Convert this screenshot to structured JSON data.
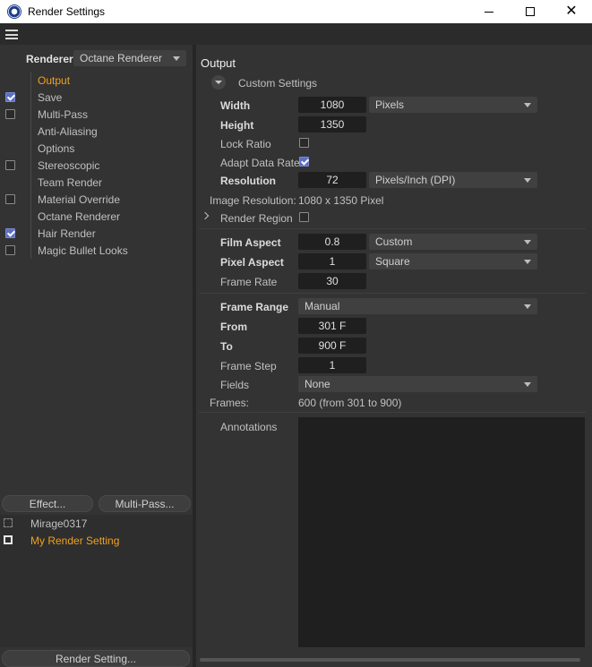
{
  "window": {
    "title": "Render Settings",
    "close_glyph": "✕"
  },
  "left": {
    "renderer_label": "Renderer",
    "renderer_value": "Octane Renderer",
    "passes": [
      {
        "label": "Output",
        "checkbox": "none",
        "active": true
      },
      {
        "label": "Save",
        "checkbox": "checked",
        "active": false
      },
      {
        "label": "Multi-Pass",
        "checkbox": "unchecked",
        "active": false
      },
      {
        "label": "Anti-Aliasing",
        "checkbox": "none",
        "active": false
      },
      {
        "label": "Options",
        "checkbox": "none",
        "active": false
      },
      {
        "label": "Stereoscopic",
        "checkbox": "unchecked",
        "active": false
      },
      {
        "label": "Team Render",
        "checkbox": "none",
        "active": false
      },
      {
        "label": "Material Override",
        "checkbox": "unchecked",
        "active": false
      },
      {
        "label": "Octane Renderer",
        "checkbox": "none",
        "active": false
      },
      {
        "label": "Hair Render",
        "checkbox": "checked",
        "active": false
      },
      {
        "label": "Magic Bullet Looks",
        "checkbox": "unchecked",
        "active": false
      }
    ],
    "effect_button": "Effect...",
    "multipass_button": "Multi-Pass...",
    "settings": [
      {
        "label": "Mirage0317",
        "active": false
      },
      {
        "label": "My Render Setting",
        "active": true
      }
    ],
    "render_setting_button": "Render Setting..."
  },
  "output": {
    "section_title": "Output",
    "custom_settings": "Custom Settings",
    "width_label": "Width",
    "width_value": "1080",
    "width_unit": "Pixels",
    "height_label": "Height",
    "height_value": "1350",
    "lock_ratio_label": "Lock Ratio",
    "lock_ratio_checked": false,
    "adapt_data_rate_label": "Adapt Data Rate",
    "adapt_data_rate_checked": true,
    "resolution_label": "Resolution",
    "resolution_value": "72",
    "resolution_unit": "Pixels/Inch (DPI)",
    "image_resolution_label": "Image Resolution:",
    "image_resolution_value": "1080 x 1350 Pixel",
    "render_region_label": "Render Region",
    "render_region_checked": false,
    "film_aspect_label": "Film Aspect",
    "film_aspect_value": "0.8",
    "film_aspect_preset": "Custom",
    "pixel_aspect_label": "Pixel Aspect",
    "pixel_aspect_value": "1",
    "pixel_aspect_preset": "Square",
    "frame_rate_label": "Frame Rate",
    "frame_rate_value": "30",
    "frame_range_label": "Frame Range",
    "frame_range_value": "Manual",
    "from_label": "From",
    "from_value": "301 F",
    "to_label": "To",
    "to_value": "900 F",
    "frame_step_label": "Frame Step",
    "frame_step_value": "1",
    "fields_label": "Fields",
    "fields_value": "None",
    "frames_label": "Frames:",
    "frames_value": "600 (from 301 to 900)",
    "annotations_label": "Annotations"
  },
  "colors": {
    "active_text": "#f0a020",
    "checkbox_on": "#5c6fc4",
    "panel_bg": "#333333",
    "field_bg": "#1f1f1f"
  }
}
